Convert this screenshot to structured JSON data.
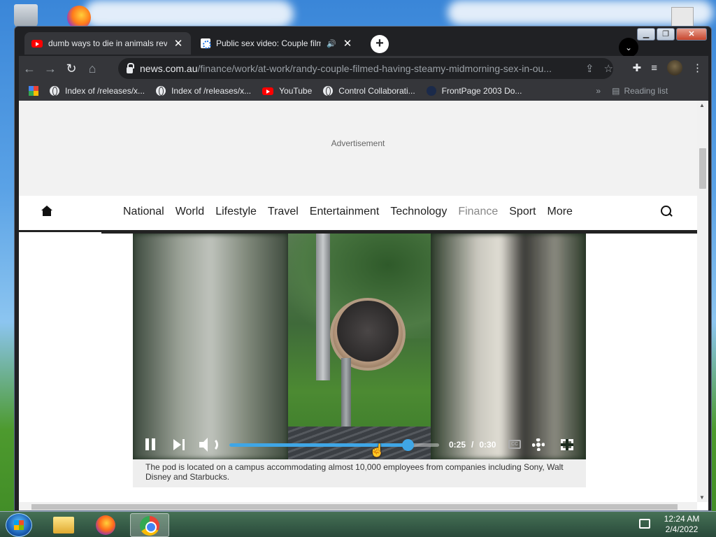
{
  "browser": {
    "tabs": [
      {
        "title": "dumb ways to die in animals reve",
        "favicon": "youtube-icon",
        "active": true
      },
      {
        "title": "Public sex video: Couple film",
        "favicon": "news-icon",
        "active": false
      }
    ],
    "url": {
      "host": "news.com.au",
      "path": "/finance/work/at-work/randy-couple-filmed-having-steamy-midmorning-sex-in-ou..."
    },
    "bookmarks": [
      {
        "label": "Index of /releases/x...",
        "icon": "globe-icon"
      },
      {
        "label": "Index of /releases/x...",
        "icon": "globe-icon"
      },
      {
        "label": "YouTube",
        "icon": "youtube-icon"
      },
      {
        "label": "Control Collaborati...",
        "icon": "globe-icon"
      },
      {
        "label": "FrontPage 2003 Do...",
        "icon": "frontpage-icon"
      }
    ],
    "more_bookmarks": "»",
    "reading_list": "Reading list"
  },
  "page": {
    "ad_label": "Advertisement",
    "nav": [
      "National",
      "World",
      "Lifestyle",
      "Travel",
      "Entertainment",
      "Technology",
      "Finance",
      "Sport",
      "More"
    ],
    "active_nav": "Finance",
    "video": {
      "current_time": "0:25",
      "separator": "/",
      "duration": "0:30",
      "progress": 0.85,
      "cc": "CC"
    },
    "caption": "The pod is located on a campus accommodating almost 10,000 employees from companies including Sony, Walt Disney and Starbucks."
  },
  "taskbar": {
    "time": "12:24 AM",
    "date": "2/4/2022"
  },
  "colors": {
    "accent": "#3fa6e6",
    "chrome_dark": "#202124",
    "toolbar": "#35363a"
  }
}
